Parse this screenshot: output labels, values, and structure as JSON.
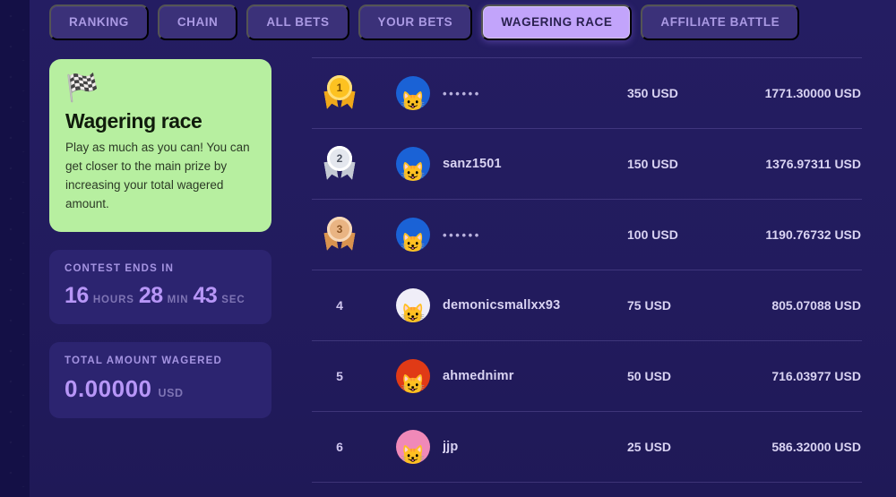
{
  "tabs": [
    {
      "label": "RANKING",
      "active": false
    },
    {
      "label": "CHAIN",
      "active": false
    },
    {
      "label": "ALL BETS",
      "active": false
    },
    {
      "label": "YOUR BETS",
      "active": false
    },
    {
      "label": "WAGERING RACE",
      "active": true
    },
    {
      "label": "AFFILIATE BATTLE",
      "active": false
    }
  ],
  "sidebar": {
    "promo": {
      "icon": "checkered-racing-flags",
      "icon_glyph": "🏁",
      "title": "Wagering race",
      "description": "Play as much as you can! You can get closer to the main prize by increasing your total wagered amount.",
      "bg_color": "#b7efa0"
    },
    "contest_timer": {
      "label": "CONTEST ENDS IN",
      "hours_value": "16",
      "hours_unit": "HOURS",
      "minutes_value": "28",
      "minutes_unit": "MIN",
      "seconds_value": "43",
      "seconds_unit": "SEC"
    },
    "total_wagered": {
      "label": "TOTAL AMOUNT WAGERED",
      "value": "0.00000",
      "currency": "USD"
    }
  },
  "leaderboard": {
    "rows": [
      {
        "rank": "1",
        "medal": "gold",
        "username": "••••••",
        "masked": true,
        "avatar_glyph": "😺",
        "avatar_bg": "#1a62d6",
        "prize": "350 USD",
        "wagered": "1771.30000 USD"
      },
      {
        "rank": "2",
        "medal": "silver",
        "username": "sanz1501",
        "masked": false,
        "avatar_glyph": "😺",
        "avatar_bg": "#1a62d6",
        "prize": "150 USD",
        "wagered": "1376.97311 USD"
      },
      {
        "rank": "3",
        "medal": "bronze",
        "username": "••••••",
        "masked": true,
        "avatar_glyph": "😺",
        "avatar_bg": "#1a62d6",
        "prize": "100 USD",
        "wagered": "1190.76732 USD"
      },
      {
        "rank": "4",
        "medal": null,
        "username": "demonicsmallxx93",
        "masked": false,
        "avatar_glyph": "😺",
        "avatar_bg": "#f0eef8",
        "prize": "75 USD",
        "wagered": "805.07088 USD"
      },
      {
        "rank": "5",
        "medal": null,
        "username": "ahmednimr",
        "masked": false,
        "avatar_glyph": "😺",
        "avatar_bg": "#e03a16",
        "prize": "50 USD",
        "wagered": "716.03977 USD"
      },
      {
        "rank": "6",
        "medal": null,
        "username": "jjp",
        "masked": false,
        "avatar_glyph": "😺",
        "avatar_bg": "#f089b8",
        "prize": "25 USD",
        "wagered": "586.32000 USD"
      }
    ]
  },
  "theme": {
    "page_bg": "#171151",
    "gutter_bg": "#141046",
    "card_bg": "#2c2470",
    "accent_purple": "#b796f7",
    "tab_active_bg": "#c2a4fb",
    "tab_inactive_bg": "#3b3179",
    "promo_green": "#b7efa0",
    "divider": "rgba(168,152,230,0.22)"
  }
}
